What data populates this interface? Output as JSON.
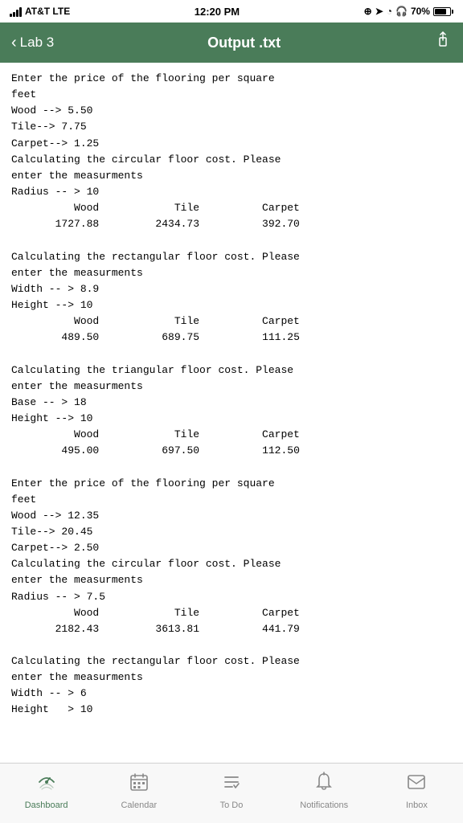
{
  "status_bar": {
    "carrier": "AT&T  LTE",
    "time": "12:20 PM",
    "battery_percent": "70%"
  },
  "nav": {
    "back_label": "Lab 3",
    "title": "Output .txt"
  },
  "content": {
    "text": "Enter the price of the flooring per square\nfeet\nWood --> 5.50\nTile--> 7.75\nCarpet--> 1.25\nCalculating the circular floor cost. Please\nenter the measurments\nRadius -- > 10\n          Wood            Tile          Carpet\n       1727.88         2434.73          392.70\n\nCalculating the rectangular floor cost. Please\nenter the measurments\nWidth -- > 8.9\nHeight --> 10\n          Wood            Tile          Carpet\n        489.50          689.75          111.25\n\nCalculating the triangular floor cost. Please\nenter the measurments\nBase -- > 18\nHeight --> 10\n          Wood            Tile          Carpet\n        495.00          697.50          112.50\n\nEnter the price of the flooring per square\nfeet\nWood --> 12.35\nTile--> 20.45\nCarpet--> 2.50\nCalculating the circular floor cost. Please\nenter the measurments\nRadius -- > 7.5\n          Wood            Tile          Carpet\n       2182.43         3613.81          441.79\n\nCalculating the rectangular floor cost. Please\nenter the measurments\nWidth -- > 6\nHeight   > 10"
  },
  "tabs": [
    {
      "id": "dashboard",
      "label": "Dashboard",
      "icon": "dashboard",
      "active": true
    },
    {
      "id": "calendar",
      "label": "Calendar",
      "icon": "calendar",
      "active": false
    },
    {
      "id": "todo",
      "label": "To Do",
      "icon": "todo",
      "active": false
    },
    {
      "id": "notifications",
      "label": "Notifications",
      "icon": "notifications",
      "active": false
    },
    {
      "id": "inbox",
      "label": "Inbox",
      "icon": "inbox",
      "active": false
    }
  ]
}
